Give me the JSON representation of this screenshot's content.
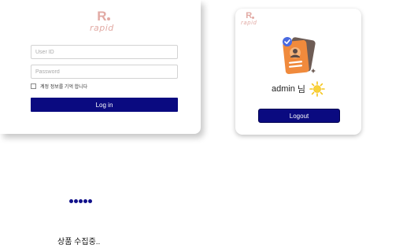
{
  "brand": {
    "mark": "R",
    "wordmark": "rapid",
    "color": "#e2aaa4"
  },
  "login": {
    "userid_placeholder": "User ID",
    "password_placeholder": "Password",
    "remember_label": "계정 정보를 기억 합니다",
    "login_button": "Log in"
  },
  "account": {
    "username": "admin",
    "honorific": "님",
    "logout_button": "Logout",
    "badge_icon": "id-badge-icon",
    "weather_icon": "sun-icon"
  },
  "status": {
    "loading_text": "상품 수집중.."
  },
  "colors": {
    "primary": "#0a0a80",
    "loader": "#10108a",
    "badge_orange": "#f08a3c",
    "badge_check": "#4a6ae0",
    "sun": "#f5c518"
  }
}
